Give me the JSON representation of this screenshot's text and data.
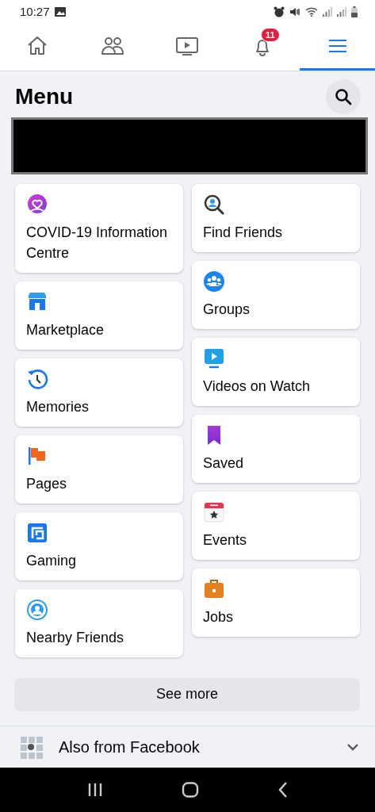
{
  "status_bar": {
    "time": "10:27"
  },
  "nav_tabs": [
    {
      "kind": "home",
      "selected": false
    },
    {
      "kind": "friends",
      "selected": false
    },
    {
      "kind": "watch",
      "selected": false
    },
    {
      "kind": "notifications",
      "selected": false,
      "badge": "11"
    },
    {
      "kind": "menu",
      "selected": true
    }
  ],
  "header": {
    "title": "Menu"
  },
  "shortcuts": {
    "left": [
      {
        "kind": "covid",
        "label": "COVID-19 Information Centre"
      },
      {
        "kind": "marketplace",
        "label": "Marketplace"
      },
      {
        "kind": "memories",
        "label": "Memories"
      },
      {
        "kind": "pages",
        "label": "Pages"
      },
      {
        "kind": "gaming",
        "label": "Gaming"
      },
      {
        "kind": "nearby",
        "label": "Nearby Friends"
      }
    ],
    "right": [
      {
        "kind": "find-friends",
        "label": "Find Friends"
      },
      {
        "kind": "groups",
        "label": "Groups"
      },
      {
        "kind": "videos",
        "label": "Videos on Watch"
      },
      {
        "kind": "saved",
        "label": "Saved"
      },
      {
        "kind": "events",
        "label": "Events"
      },
      {
        "kind": "jobs",
        "label": "Jobs"
      }
    ]
  },
  "see_more": "See more",
  "also_from": {
    "label": "Also from Facebook",
    "expanded": false
  }
}
